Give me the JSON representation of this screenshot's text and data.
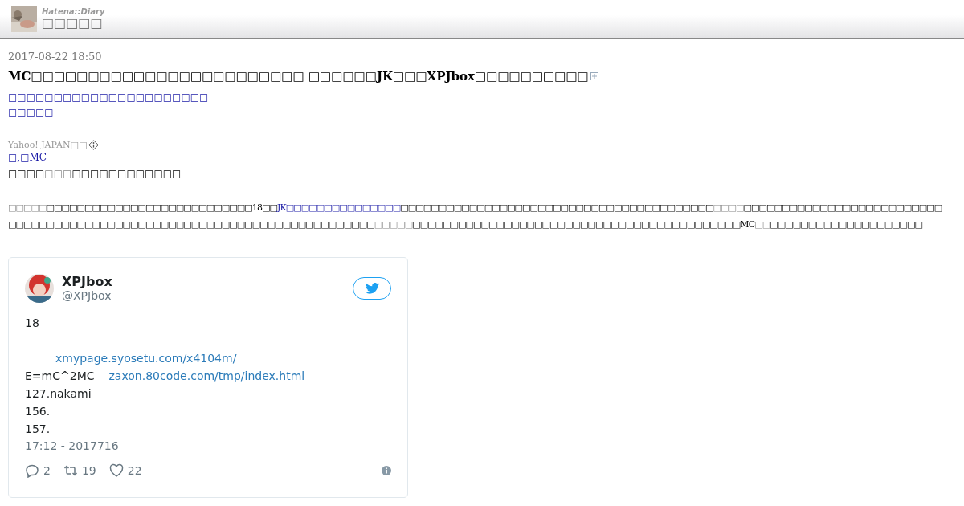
{
  "header": {
    "brand": "Hatena::Diary",
    "blog_title": "□□□□□"
  },
  "entry": {
    "date": "2017-08-22 18:50",
    "title": "MC□□□□□□□□□□□□□□□□□□□□□□□□ □□□□□□JK□□□XPJbox□□□□□□□□□□",
    "links": [
      "□□□□□□□□□□□□□□□□□□□□□□",
      "□□□□□"
    ],
    "source": "Yahoo! JAPAN□□",
    "tag_link": "□,□MC",
    "lead": [
      {
        "text": "□□□□",
        "kind": "plain"
      },
      {
        "text": "□□□",
        "kind": "keyword"
      },
      {
        "text": "□□□□□□□□□□□□",
        "kind": "plain"
      }
    ],
    "paragraph": [
      {
        "text": "□□□□□",
        "kind": "keyword"
      },
      {
        "text": "□□□□□□□□□□□□□□□□□□□□□□□□□□□",
        "kind": "plain"
      },
      {
        "text": "18□□",
        "kind": "plain"
      },
      {
        "text": "JK□□□□□□□□□□□□□□□",
        "kind": "link"
      },
      {
        "text": "□□□□□□□□□□□□□□□□□□□□□□□□□□□□□□□□□□□□□□□□□",
        "kind": "plain"
      },
      {
        "text": "□□□□",
        "kind": "keyword"
      },
      {
        "text": "□□□□□□□□□□□□□□□□□□□□□□□□□□□□□□□□□□□□□□□□□□□□□□□□□□□□□□□□□□□□□□□□□□□□□□□□□□",
        "kind": "plain"
      },
      {
        "text": "□□□□□",
        "kind": "keyword"
      },
      {
        "text": "□□□□□□□□□□□□□□□□□□□□□□□□□□□□□□□□□□□□□□□□□□□MC",
        "kind": "plain"
      },
      {
        "text": "□□",
        "kind": "keyword"
      },
      {
        "text": "□□□□□□□□□□□□□□□□□□□□",
        "kind": "plain"
      }
    ]
  },
  "tweet": {
    "name": "XPJbox",
    "handle": "@XPJbox",
    "paragraphs": [
      {
        "lines": [
          {
            "parts": [
              {
                "text": "18",
                "kind": "plain"
              }
            ]
          }
        ]
      },
      {
        "lines": [
          {
            "parts": [
              {
                "text": "xmypage.syosetu.com/x4104m/",
                "kind": "link"
              }
            ],
            "indent": true
          },
          {
            "parts": [
              {
                "text": "E=mC^2MC",
                "kind": "plain"
              },
              {
                "text": "zaxon.80code.com/tmp/index.html",
                "kind": "link"
              }
            ]
          },
          {
            "parts": [
              {
                "text": "127.nakami",
                "kind": "plain"
              }
            ]
          },
          {
            "parts": [
              {
                "text": "156.",
                "kind": "plain"
              }
            ]
          },
          {
            "parts": [
              {
                "text": "157.",
                "kind": "plain"
              }
            ]
          }
        ]
      }
    ],
    "time": "17:12 - 2017716",
    "replies": "2",
    "retweets": "19",
    "likes": "22"
  }
}
